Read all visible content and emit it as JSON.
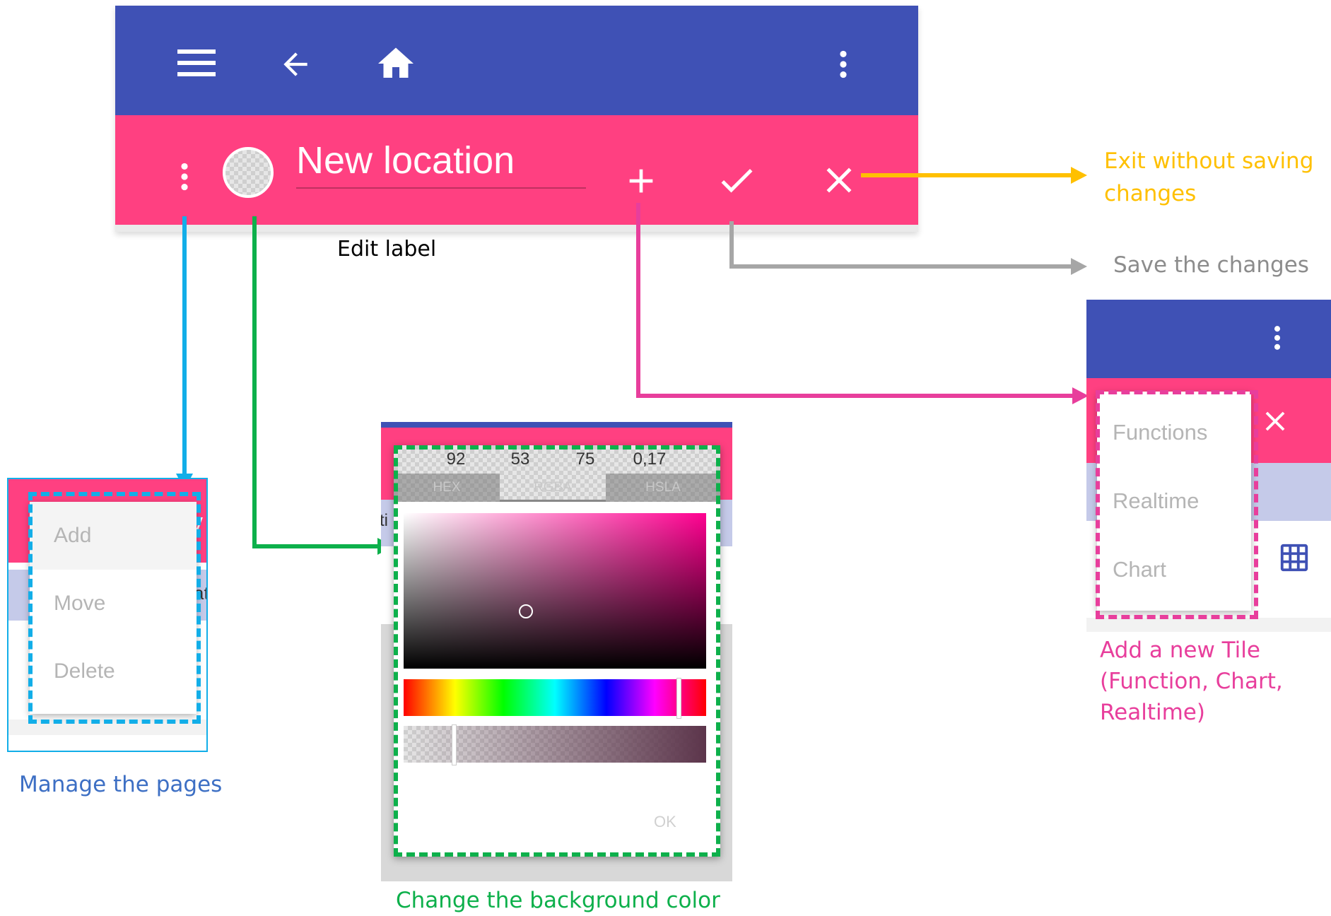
{
  "toolbar": {
    "title": "New location",
    "icons": [
      "menu-icon",
      "back-arrow-icon",
      "home-icon",
      "more-vertical-icon",
      "more-vertical-icon",
      "color-swatch-icon",
      "plus-icon",
      "check-icon",
      "close-icon"
    ]
  },
  "annotations": {
    "edit_label": "Edit label",
    "exit_line1": "Exit without saving",
    "exit_line2": "changes",
    "save": "Save the changes",
    "add_tile_line1": "Add a new Tile",
    "add_tile_line2": "(Function, Chart,",
    "add_tile_line3": "Realtime)",
    "manage_pages": "Manage the pages",
    "change_bg": "Change the background color"
  },
  "page_menu": {
    "items": [
      "Add",
      "Move",
      "Delete"
    ],
    "partial_text_1": "v",
    "partial_text_2": "atu"
  },
  "color_picker": {
    "values": [
      "92",
      "53",
      "75",
      "0,17"
    ],
    "tabs": [
      "HEX",
      "RGBA",
      "HSLA"
    ],
    "active_tab": "RGBA",
    "ok_label": "OK",
    "partial_text": "ti",
    "selected_hue_color": "#ff0055",
    "alpha_fraction": 0.17
  },
  "tile_menu": {
    "items": [
      "Functions",
      "Realtime",
      "Chart"
    ]
  },
  "colors": {
    "primary": "#3f51b5",
    "accent": "#ff4081",
    "arrow_yellow": "#ffc000",
    "arrow_gray": "#a6a6a6",
    "arrow_pink": "#e83e9c",
    "arrow_green": "#0db04b",
    "arrow_blue": "#12aee8"
  }
}
